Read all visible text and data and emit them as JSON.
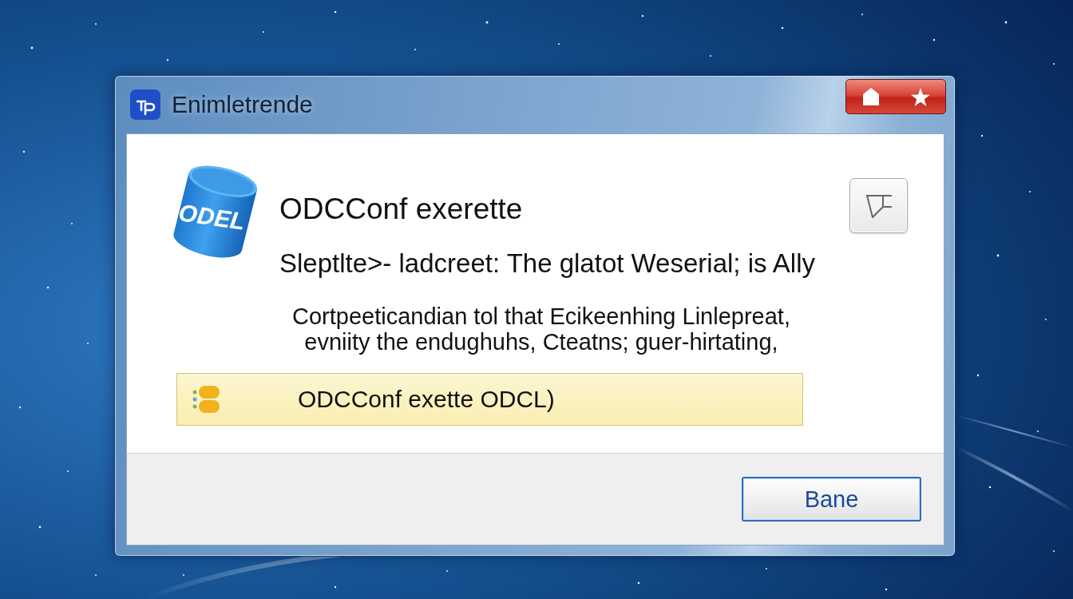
{
  "window": {
    "title": "Enimletrende",
    "title_buttons": [
      {
        "kind": "home"
      },
      {
        "kind": "star"
      }
    ]
  },
  "message": {
    "logo_text": "ODEL",
    "heading": "ODCConf exerette",
    "subheading": "Sleptlte>- ladcreet: The glatot Weserial; is Ally",
    "body_lines": [
      "Cortpeeticandian tol that Ecikeenhing Linlepreat,",
      "evniity the endughuhs, Cteatns; guer-hirtating,"
    ],
    "notice": {
      "text": "ODCConf exette ODCL)"
    }
  },
  "buttons": [
    {
      "label": "Bane",
      "default": true
    }
  ]
}
